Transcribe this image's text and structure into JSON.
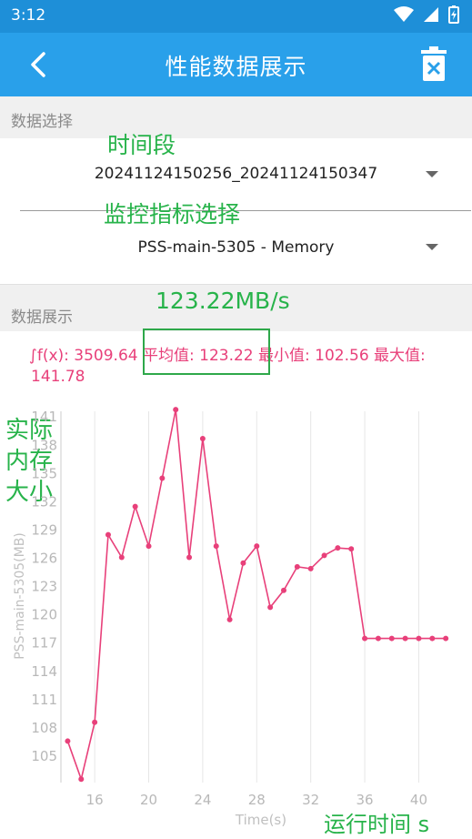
{
  "status": {
    "time": "3:12"
  },
  "toolbar": {
    "title": "性能数据展示"
  },
  "data_select": {
    "header": "数据选择",
    "period_value": "20241124150256_20241124150347",
    "metric_value": "PSS-main-5305 - Memory"
  },
  "data_display": {
    "header": "数据展示",
    "stats_line1": "∫f(x): 3509.64 平均值: 123.22 最小值: 102.56 最大值:",
    "stats_line2": "141.78"
  },
  "annotations": {
    "period": "时间段",
    "metric": "监控指标选择",
    "rate": "123.22MB/s",
    "actual_mem": [
      "实际",
      "内存",
      "大小"
    ],
    "runtime": "运行时间 s"
  },
  "colors": {
    "statusbar": "#1e8fd8",
    "toolbar": "#29a0ea",
    "line": "#e8407a",
    "annotation": "#27b34a"
  },
  "chart_data": {
    "type": "line",
    "xlabel": "Time(s)",
    "ylabel": "PSS-main-5305(MB)",
    "x_ticks": [
      16,
      20,
      24,
      28,
      32,
      36,
      40
    ],
    "y_ticks": [
      105,
      108,
      111,
      114,
      117,
      120,
      123,
      126,
      129,
      132,
      135,
      138,
      141
    ],
    "xlim": [
      13.5,
      43
    ],
    "ylim": [
      102.2,
      141.6
    ],
    "series": [
      {
        "x": [
          14,
          15,
          16,
          17,
          18,
          19,
          20,
          21,
          22,
          23,
          24,
          25,
          26,
          27,
          28,
          29,
          30,
          31,
          32,
          33,
          34,
          35,
          36,
          37,
          38,
          39,
          40,
          41,
          42
        ],
        "y": [
          106.6,
          102.56,
          108.6,
          128.5,
          126.1,
          131.5,
          127.3,
          134.5,
          141.78,
          126.1,
          138.7,
          127.3,
          119.5,
          125.5,
          127.3,
          120.8,
          122.6,
          125.1,
          124.9,
          126.3,
          127.1,
          127.0,
          117.5,
          117.5,
          117.5,
          117.5,
          117.5,
          117.5,
          117.5
        ]
      }
    ]
  }
}
